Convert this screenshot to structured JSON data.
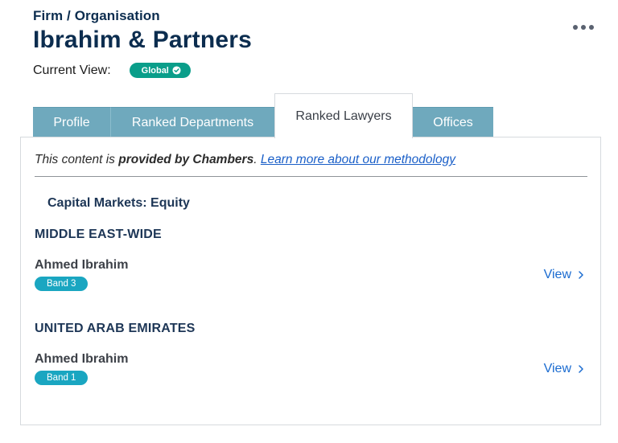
{
  "header": {
    "eyebrow": "Firm / Organisation",
    "firm_name": "Ibrahim & Partners",
    "view_label": "Current View:",
    "view_badge": "Global"
  },
  "tabs": [
    {
      "label": "Profile",
      "active": false
    },
    {
      "label": "Ranked Departments",
      "active": false
    },
    {
      "label": "Ranked Lawyers",
      "active": true
    },
    {
      "label": "Offices",
      "active": false
    }
  ],
  "content": {
    "provided_prefix": "This content is ",
    "provided_bold": "provided by Chambers",
    "provided_sep": ". ",
    "methodology_link": "Learn more about our methodology",
    "section_title": "Capital Markets: Equity",
    "regions": [
      {
        "name": "MIDDLE EAST-WIDE",
        "lawyer": {
          "name": "Ahmed Ibrahim",
          "band": "Band 3",
          "link": "View"
        }
      },
      {
        "name": "UNITED ARAB EMIRATES",
        "lawyer": {
          "name": "Ahmed Ibrahim",
          "band": "Band 1",
          "link": "View"
        }
      }
    ]
  },
  "colors": {
    "brand_navy": "#0c2d4f",
    "global_badge": "#0a9e8a",
    "tab_inactive": "#6fa9bd",
    "band_badge": "#1aa6c1",
    "link": "#1a6bd0"
  },
  "icons": {
    "more": "more-horizontal-icon",
    "badge_check": "check-circle-icon",
    "view_chevron": "chevron-right-icon"
  }
}
